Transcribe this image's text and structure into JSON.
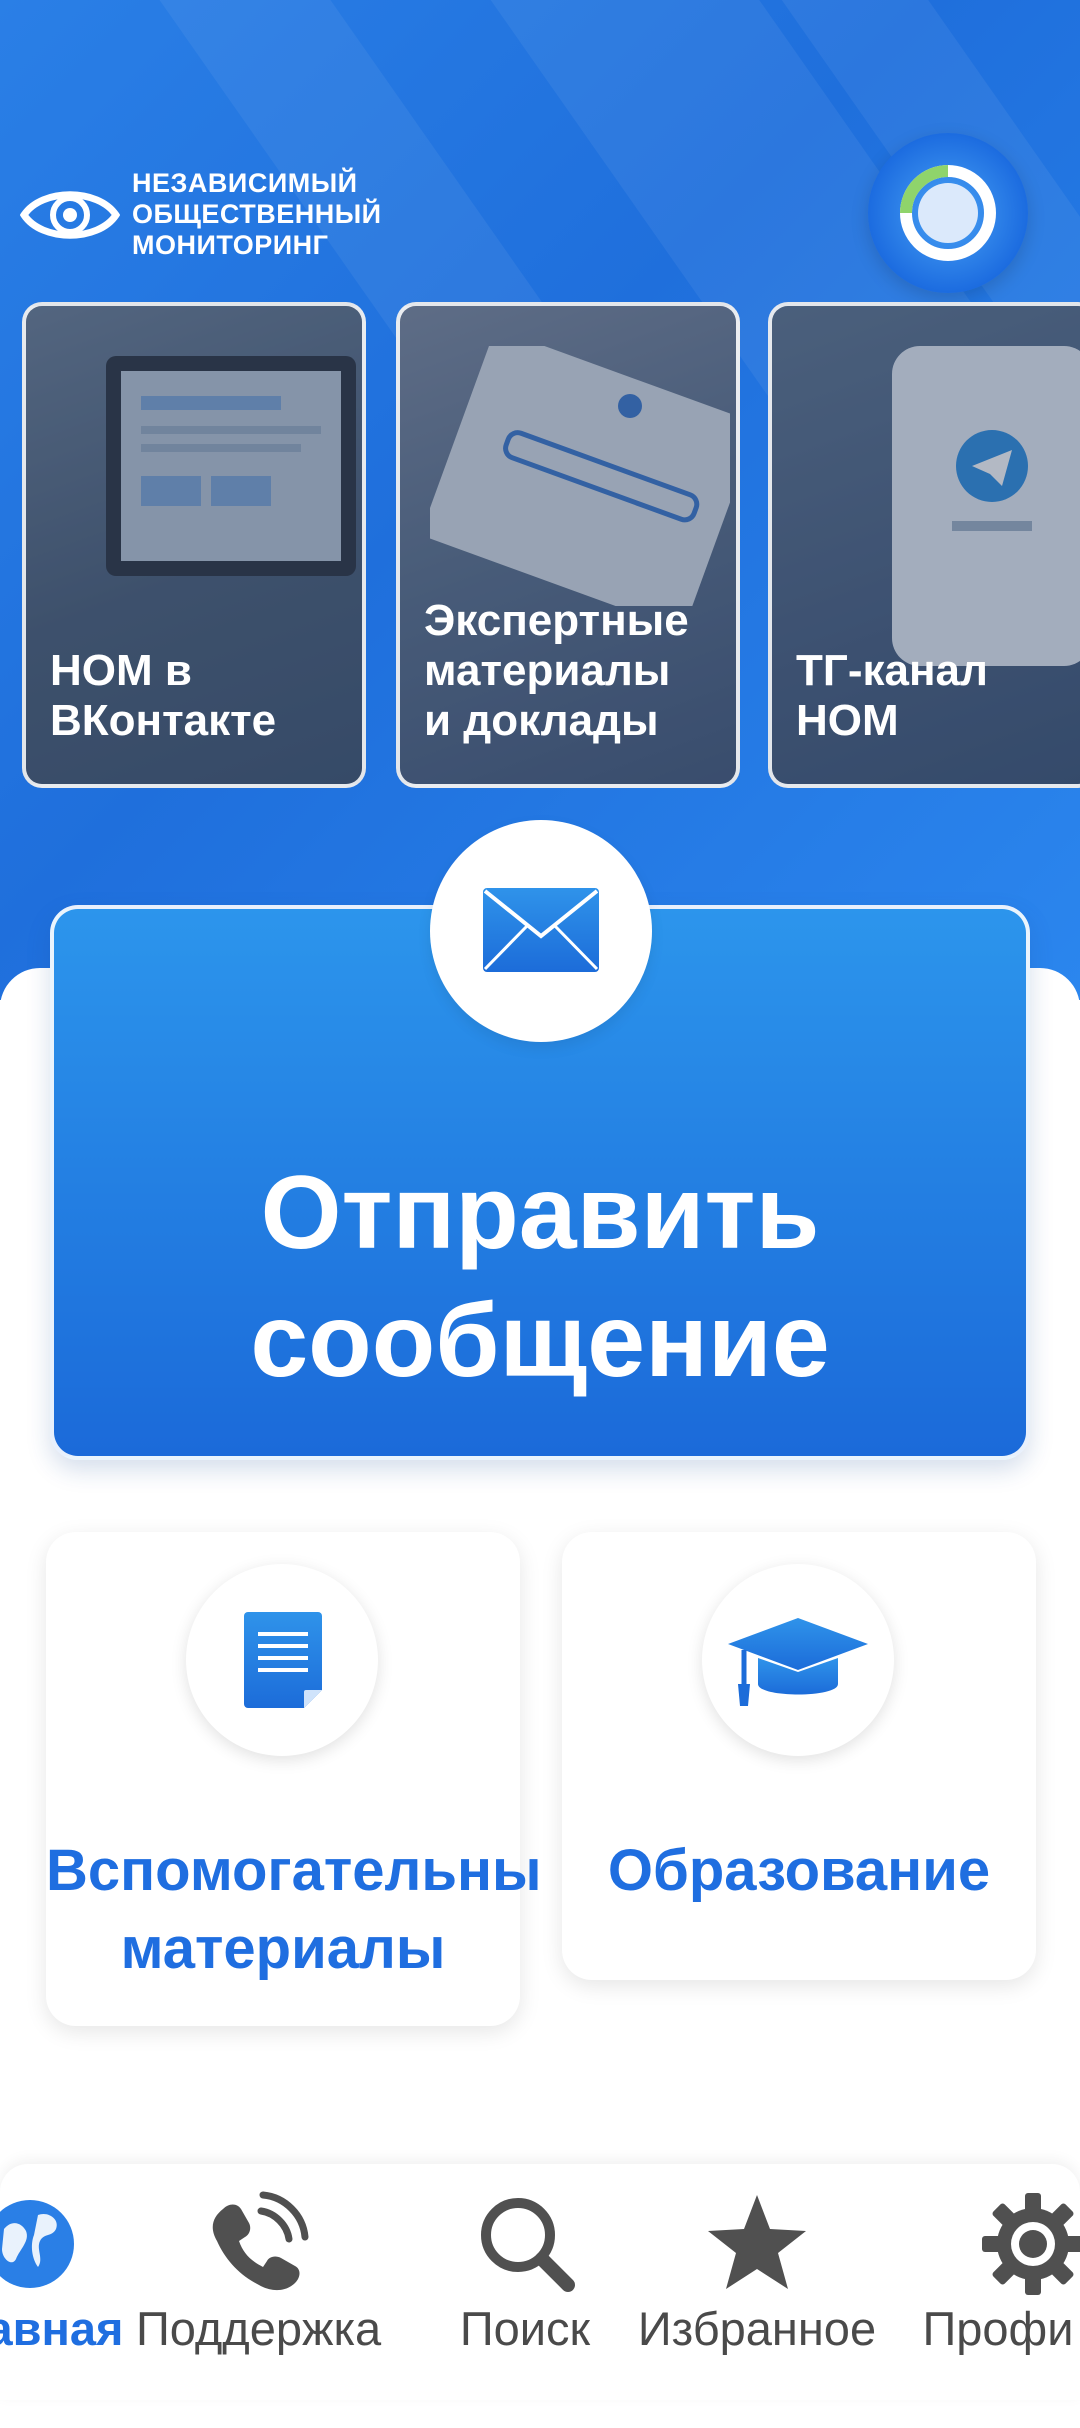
{
  "header": {
    "logo_lines": [
      "НЕЗАВИСИМЫЙ",
      "ОБЩЕСТВЕННЫЙ",
      "МОНИТОРИНГ"
    ]
  },
  "cards": [
    {
      "title_lines": [
        "НОМ в",
        "ВКонтакте"
      ]
    },
    {
      "title_lines": [
        "Экспертные",
        "материалы",
        "и доклады"
      ]
    },
    {
      "title_lines": [
        "ТГ-канал",
        "НОМ"
      ]
    }
  ],
  "send": {
    "title_lines": [
      "Отправить",
      "сообщение"
    ]
  },
  "tiles": [
    {
      "label": "Вспомогательны",
      "label2": "материалы",
      "icon": "document-icon"
    },
    {
      "label": "Образование",
      "icon": "graduation-cap-icon"
    }
  ],
  "nav": {
    "items": [
      {
        "label": "авная",
        "icon": "globe-icon",
        "active": true
      },
      {
        "label": "Поддержка",
        "icon": "phone-icon"
      },
      {
        "label": "Поиск",
        "icon": "search-icon"
      },
      {
        "label": "Избранное",
        "icon": "star-icon"
      },
      {
        "label": "Профи",
        "icon": "gear-icon"
      }
    ]
  },
  "colors": {
    "primary": "#1f6ee0",
    "hero": "#2a7fe6"
  }
}
